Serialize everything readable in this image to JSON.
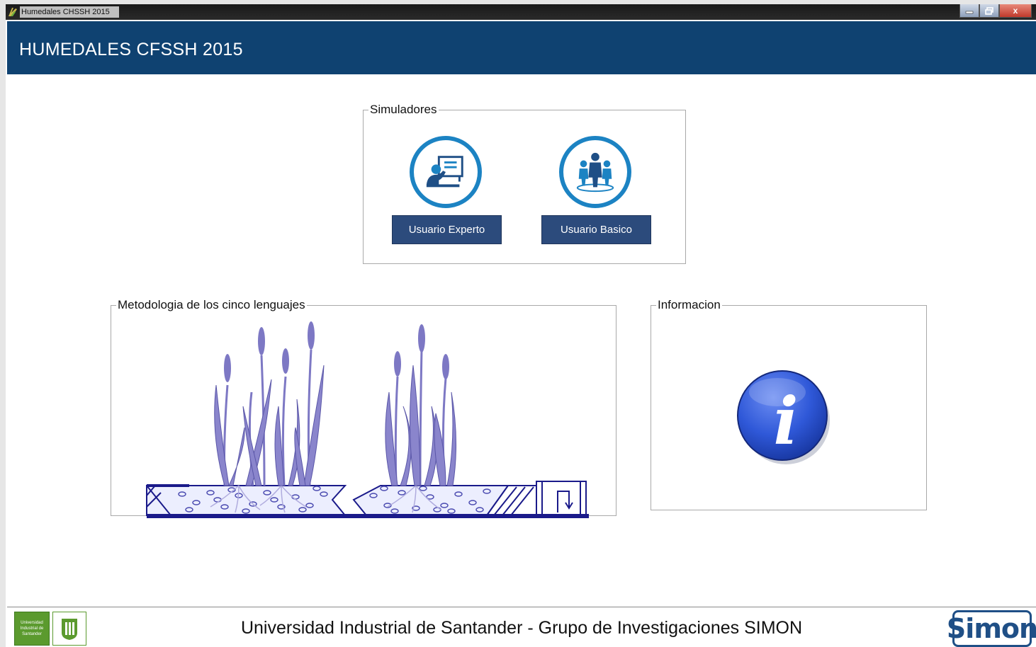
{
  "window": {
    "title": "Humedales CHSSH 2015",
    "controls": {
      "minimize": "–",
      "maximize": "□",
      "close": "x"
    }
  },
  "header": {
    "title": "HUMEDALES CFSSH 2015"
  },
  "simuladores": {
    "legend": "Simuladores",
    "expert": {
      "label": "Usuario Experto",
      "icon": "presentation-icon"
    },
    "basic": {
      "label": "Usuario Basico",
      "icon": "group-users-icon"
    }
  },
  "metodologia": {
    "legend": "Metodologia de los cinco lenguajes",
    "image": "wetland-reeds-diagram"
  },
  "informacion": {
    "legend": "Informacion",
    "icon": "info-icon",
    "icon_letter": "i"
  },
  "footer": {
    "text": "Universidad Industrial de Santander - Grupo de Investigaciones SIMON",
    "uis_logo_text": "Universidad Industrial de Santander",
    "simon_logo_text": "Simon"
  },
  "colors": {
    "header": "#0f4271",
    "button": "#2c4b7c",
    "icon_ring": "#1c83c3",
    "reed": "#7d78c4"
  }
}
